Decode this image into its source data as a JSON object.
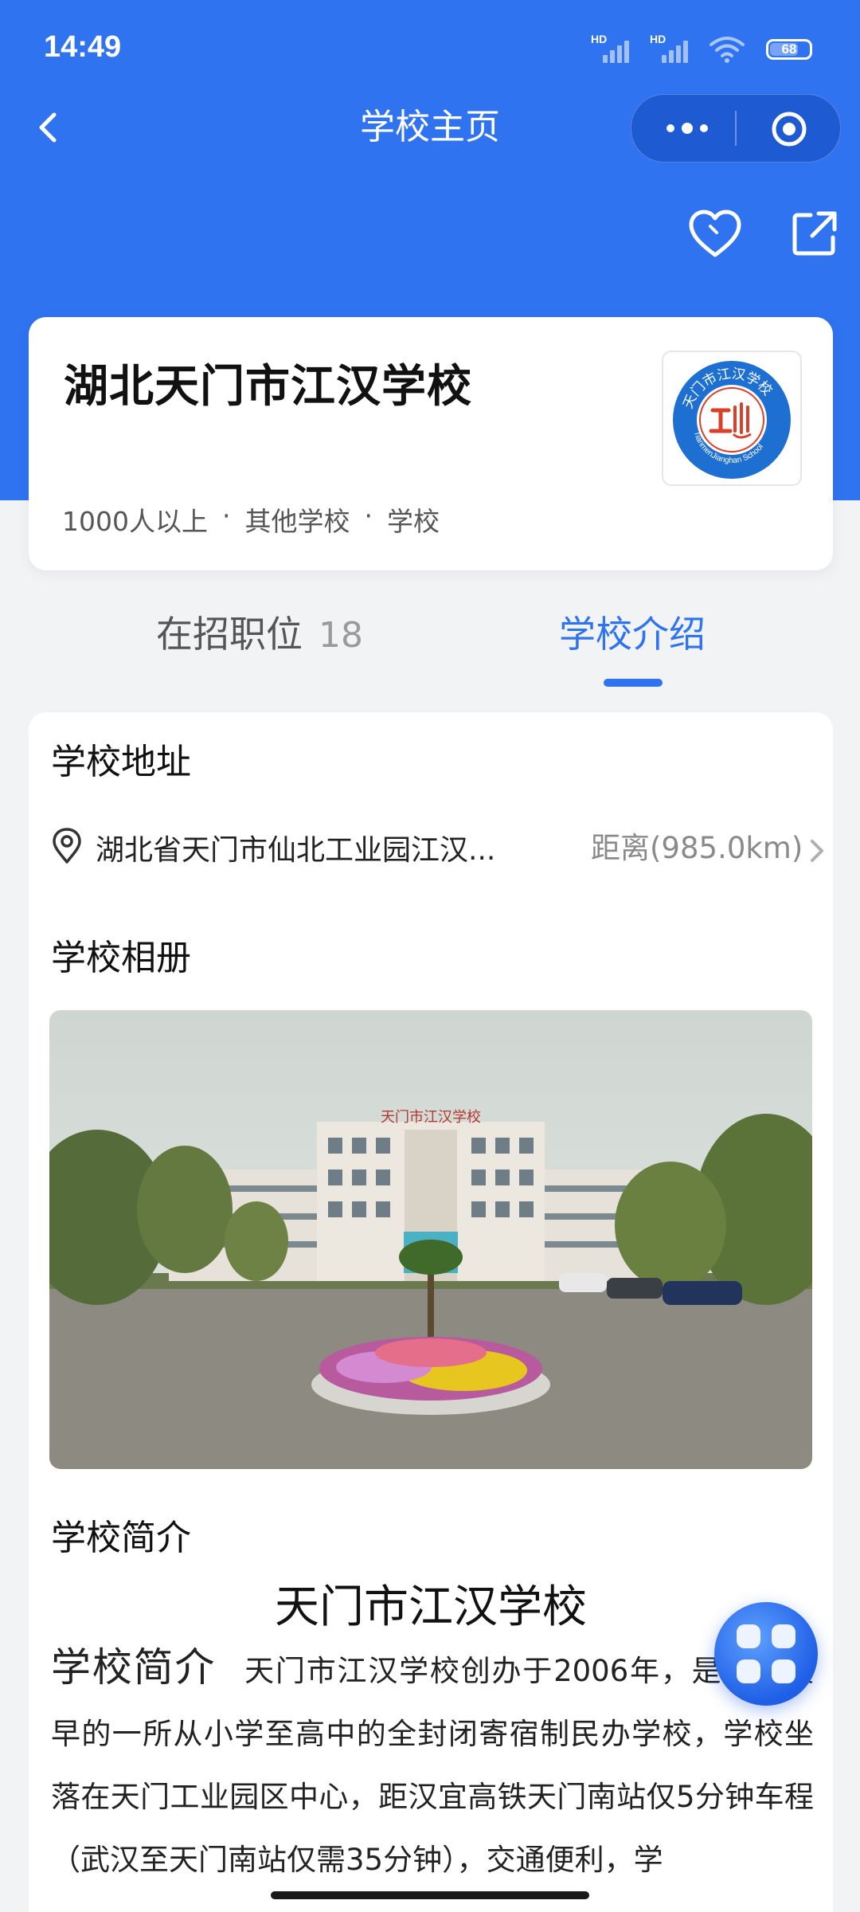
{
  "status_bar": {
    "time": "14:49",
    "signal1_label": "HD",
    "signal2_label": "HD",
    "battery": "68",
    "icons": [
      "signal-icon",
      "signal-icon",
      "wifi-icon",
      "battery-icon"
    ]
  },
  "nav": {
    "title": "学校主页",
    "back_icon": "chevron-left-icon",
    "more_icon": "more-dots-icon",
    "close_icon": "target-icon"
  },
  "actions": {
    "favorite_icon": "heart-icon",
    "share_icon": "share-icon"
  },
  "school": {
    "name": "湖北天门市江汉学校",
    "meta": [
      "1000人以上",
      "其他学校",
      "学校"
    ],
    "meta_sep": "·",
    "logo": {
      "ring_text": "天门市江汉学校",
      "english_text": "TianmenJianghan School"
    }
  },
  "tabs": [
    {
      "label": "在招职位",
      "count": "18",
      "active": false
    },
    {
      "label": "学校介绍",
      "active": true
    }
  ],
  "address_section": {
    "title": "学校地址",
    "address": "湖北省天门市仙北工业园江汉...",
    "distance": "距离(985.0km)"
  },
  "album_section": {
    "title": "学校相册",
    "photo_sign": "天门市江汉学校"
  },
  "intro_section": {
    "title": "学校简介",
    "heading": "天门市江汉学校",
    "inline_heading": "学校简介",
    "body": "天门市江汉学校创办于2006年，是天门最早的一所从小学至高中的全封闭寄宿制民办学校，学校坐落在天门工业园区中心，距汉宜高铁天门南站仅5分钟车程（武汉至天门南站仅需35分钟），交通便利，学"
  },
  "colors": {
    "brand": "#2f73f0",
    "page_bg": "#f2f3f5",
    "card_bg": "#ffffff"
  }
}
